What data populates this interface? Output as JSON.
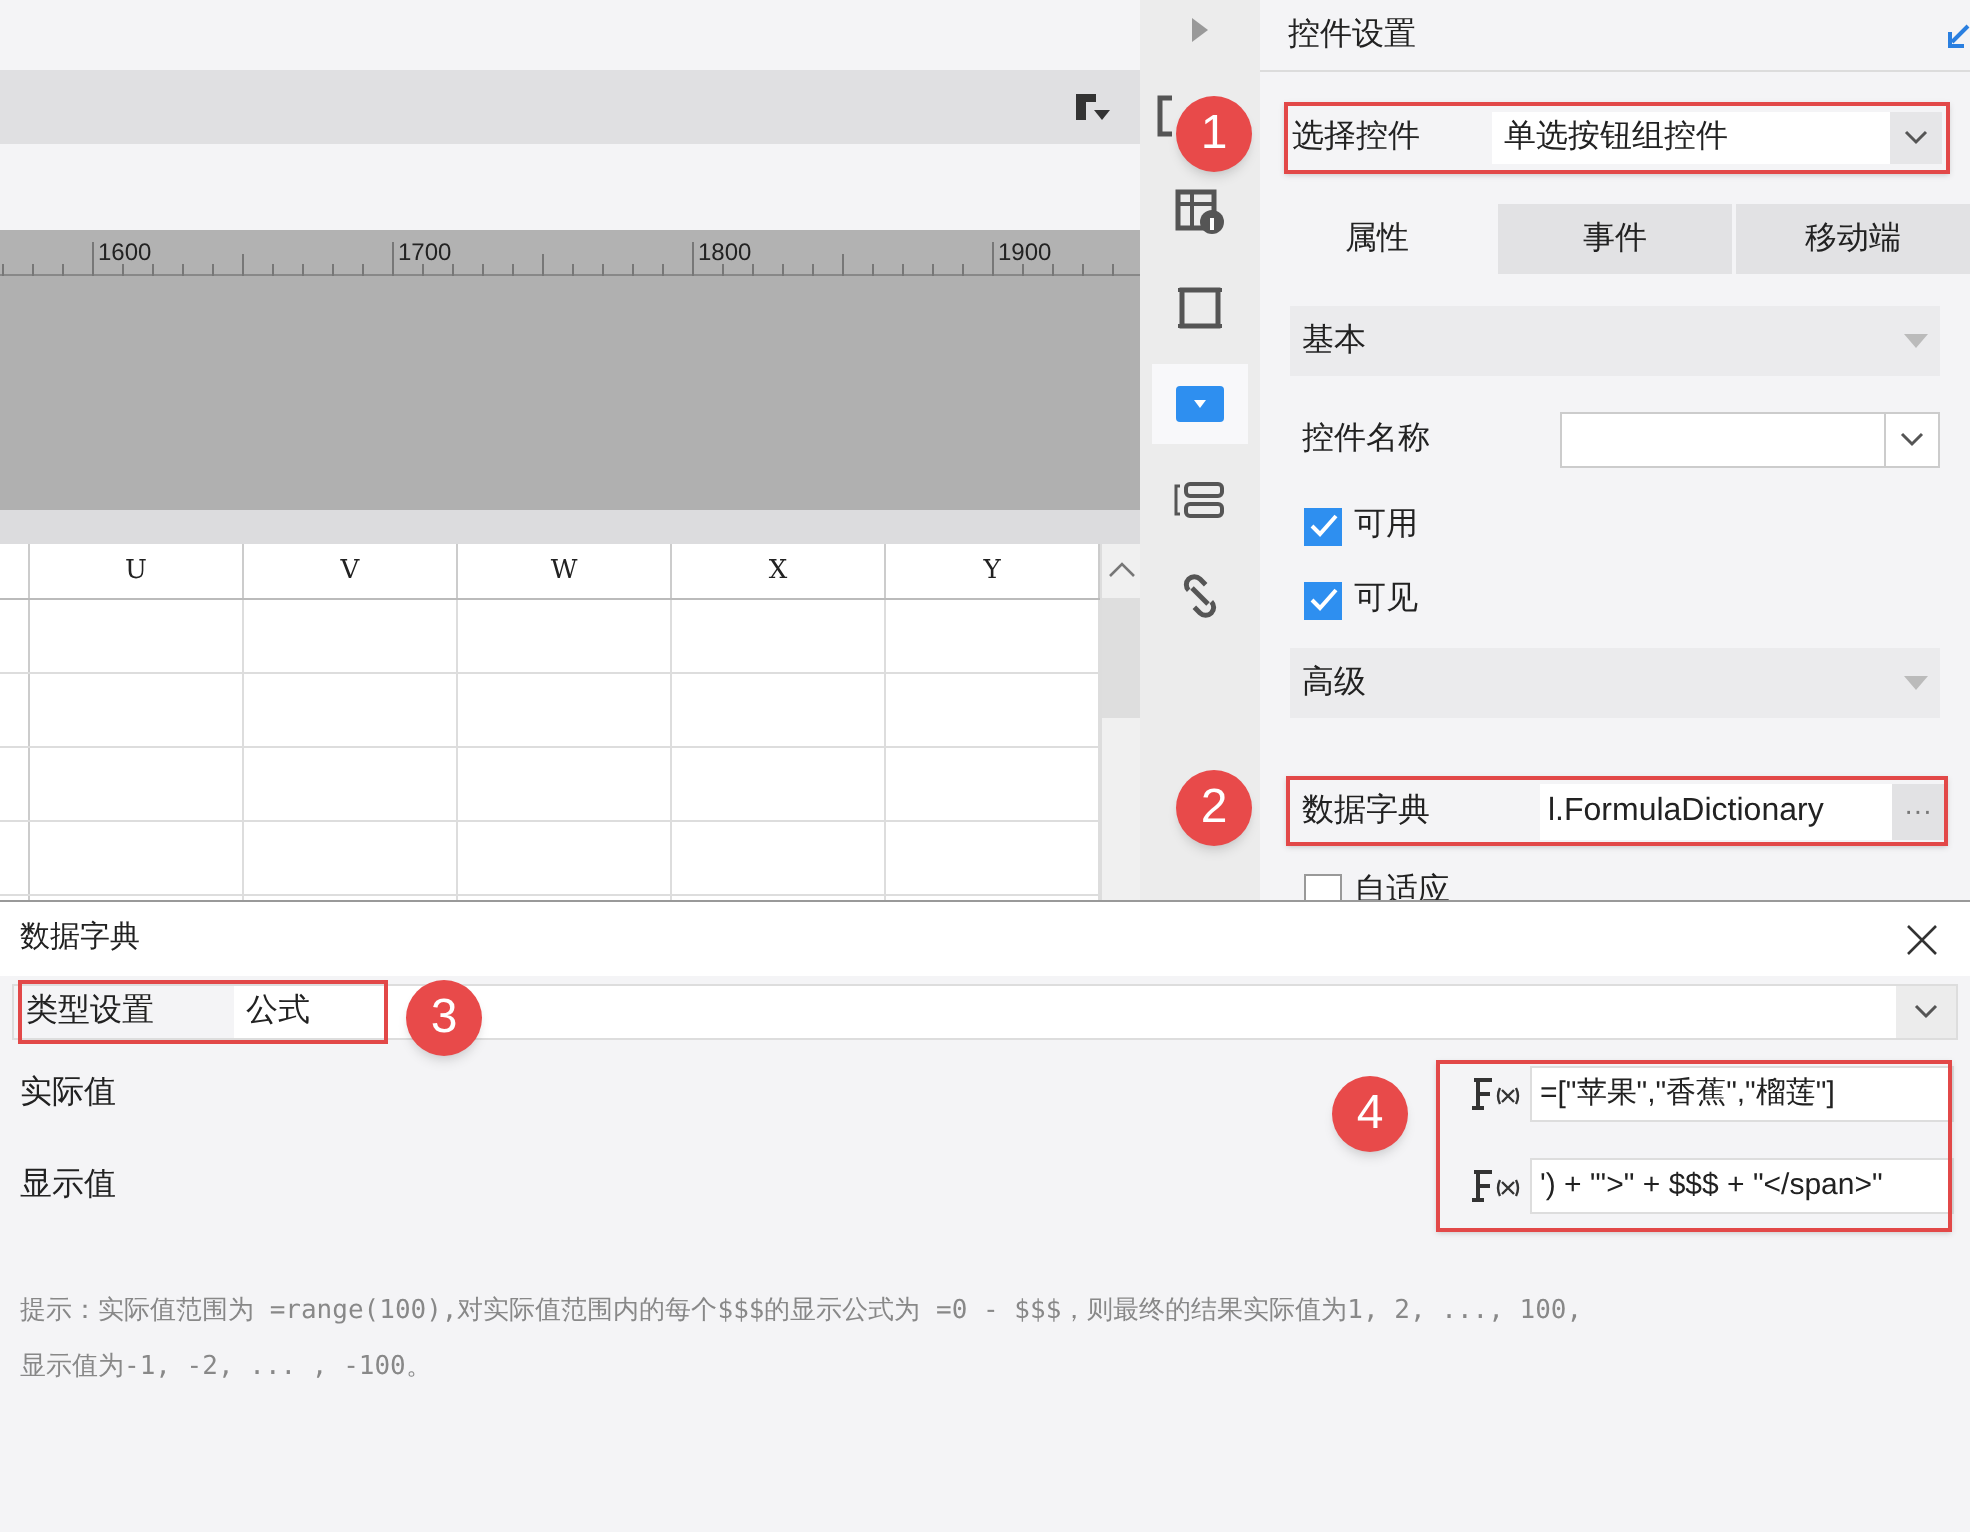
{
  "canvas": {
    "ruler_labels": [
      "1600",
      "1700",
      "1800",
      "1900"
    ],
    "columns": [
      "U",
      "V",
      "W",
      "X",
      "Y"
    ]
  },
  "side_toolbar": [
    {
      "kind": "expand",
      "selected": false
    },
    {
      "kind": "frame",
      "selected": false
    },
    {
      "kind": "table-info",
      "selected": false
    },
    {
      "kind": "square",
      "selected": false
    },
    {
      "kind": "dropdown",
      "selected": true
    },
    {
      "kind": "form",
      "selected": false
    },
    {
      "kind": "link",
      "selected": false
    }
  ],
  "panel": {
    "title": "控件设置",
    "widget_select": {
      "badge": "1",
      "label": "选择控件",
      "value": "单选按钮组控件"
    },
    "tabs": [
      {
        "label": "属性",
        "selected": true
      },
      {
        "label": "事件",
        "selected": false
      },
      {
        "label": "移动端",
        "selected": false
      }
    ],
    "basic": {
      "title": "基本",
      "name_label": "控件名称",
      "checkboxes": [
        {
          "label": "可用",
          "checked": true
        },
        {
          "label": "可见",
          "checked": true
        }
      ]
    },
    "advanced": {
      "title": "高级",
      "badge": "2",
      "dictionary_label": "数据字典",
      "dictionary_value": "l.FormulaDictionary",
      "dictionary_button": "···",
      "autofit": {
        "label": "自适应",
        "checked": false
      }
    }
  },
  "dialog": {
    "title": "数据字典",
    "type_badge": "3",
    "type_label": "类型设置",
    "type_value": "公式",
    "formula_badge": "4",
    "rows": [
      {
        "label": "实际值",
        "formula": "=[\"苹果\",\"香蕉\",\"榴莲\"]"
      },
      {
        "label": "显示值",
        "formula": "') + \"'>\" + $$$ + \"</span>\""
      }
    ],
    "hint": "提示：实际值范围为 =range(100),对实际值范围内的每个$$$的显示公式为 =0 - $$$，则最终的结果实际值为1, 2, ..., 100,显示值为-1, -2, ... , -100。"
  }
}
